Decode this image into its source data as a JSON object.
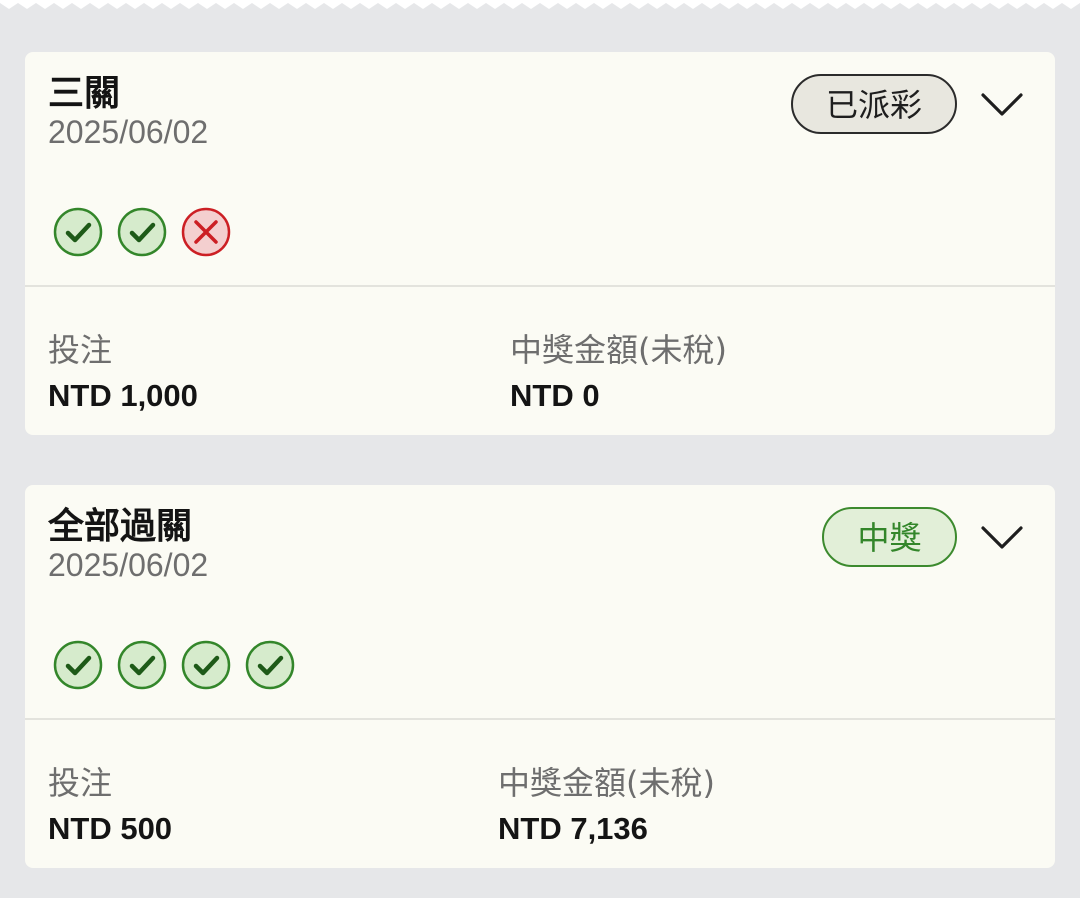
{
  "colors": {
    "background": "#e6e7e9",
    "card": "#fbfbf4",
    "win_green": "#33862a",
    "loss_red": "#cc1f24"
  },
  "bets": [
    {
      "title": "三關",
      "date": "2025/06/02",
      "status": "已派彩",
      "status_type": "paid",
      "legs": [
        "win",
        "win",
        "loss"
      ],
      "stake_label": "投注",
      "stake_value": "NTD 1,000",
      "payout_label": "中獎金額(未稅)",
      "payout_value": "NTD 0",
      "expand_icon": "chevron-down-icon"
    },
    {
      "title": "全部過關",
      "date": "2025/06/02",
      "status": "中獎",
      "status_type": "won",
      "legs": [
        "win",
        "win",
        "win",
        "win"
      ],
      "stake_label": "投注",
      "stake_value": "NTD 500",
      "payout_label": "中獎金額(未稅)",
      "payout_value": "NTD 7,136",
      "expand_icon": "chevron-down-icon"
    }
  ]
}
